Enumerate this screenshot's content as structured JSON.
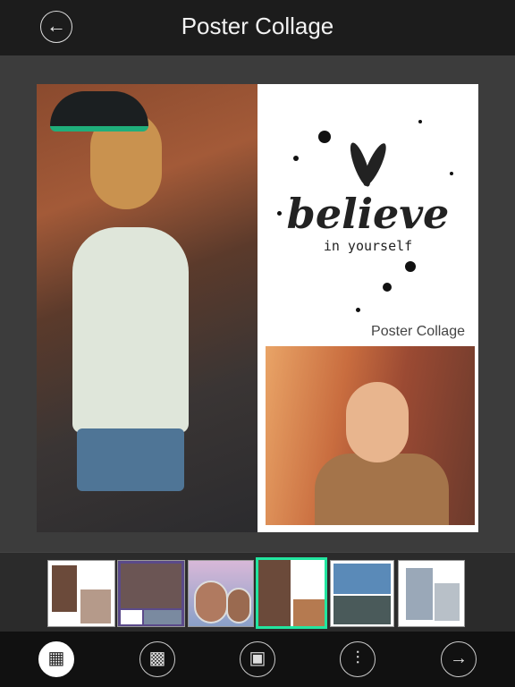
{
  "header": {
    "title": "Poster Collage",
    "back_icon": "arrow-left-icon"
  },
  "poster": {
    "artwork_text": "believe",
    "artwork_subtext": "in yourself",
    "brand_label": "Poster Collage"
  },
  "templates": {
    "selected_index": 3,
    "accent_color": "#22e6a0",
    "items": [
      {
        "name": "template-1"
      },
      {
        "name": "template-2"
      },
      {
        "name": "template-3"
      },
      {
        "name": "template-4"
      },
      {
        "name": "template-5"
      },
      {
        "name": "template-6"
      }
    ]
  },
  "toolbar": {
    "items": [
      {
        "icon": "layout-icon",
        "active": true
      },
      {
        "icon": "grid-icon",
        "active": false
      },
      {
        "icon": "image-gallery-icon",
        "active": false
      },
      {
        "icon": "adjust-sliders-icon",
        "active": false
      },
      {
        "icon": "arrow-right-icon",
        "active": false
      }
    ]
  }
}
